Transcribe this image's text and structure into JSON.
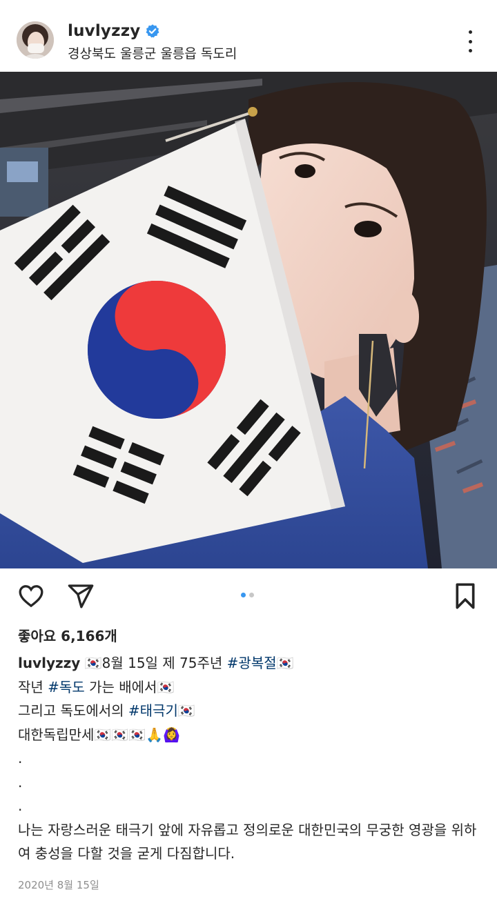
{
  "post": {
    "username": "luvlyzzy",
    "location": "경상북도 울릉군 울릉읍 독도리",
    "dot_count": 2,
    "active_dot": 0,
    "likes_text": "좋아요 6,166개",
    "caption": {
      "username": "luvlyzzy",
      "line1_text": "8월 15일 제 75주년 ",
      "line1_tag": "#광복절",
      "line2_pre": "작년 ",
      "line2_tag": "#독도",
      "line2_post": " 가는 배에서",
      "line3_pre": "그리고 독도에서의 ",
      "line3_tag": "#태극기",
      "line4_text": "대한독립만세",
      "dot_line": ".",
      "paragraph": "나는 자랑스러운 태극기 앞에 자유롭고 정의로운 대한민국의 무궁한 영광을 위하여 충성을 다할 것을 굳게 다짐합니다."
    },
    "timestamp": "2020년 8월 15일"
  },
  "colors": {
    "text": "#262626",
    "hashtag": "#00376b",
    "verified": "#3897f0",
    "muted": "#8e8e8e"
  },
  "icons": [
    "verified-badge-icon",
    "more-options-icon",
    "heart-icon",
    "send-icon",
    "bookmark-icon",
    "korean-flag-emoji",
    "praying-hands-emoji",
    "woman-emoji"
  ]
}
